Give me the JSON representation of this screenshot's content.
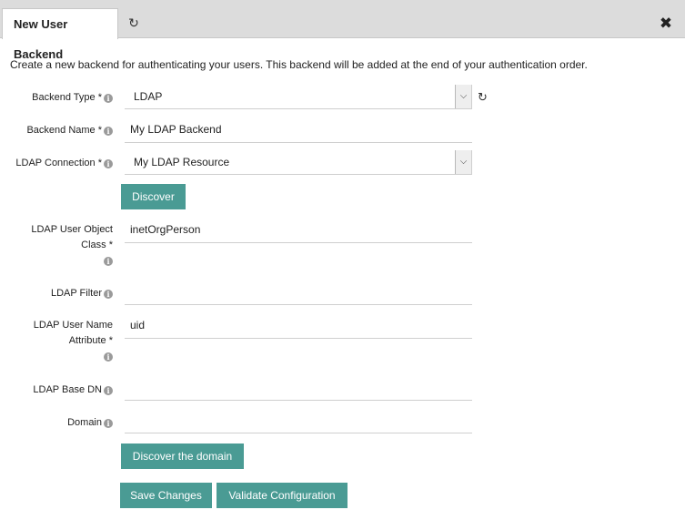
{
  "tabs": {
    "active_label": "New User Backend",
    "refresh_icon": "↻",
    "close_icon": "✖"
  },
  "description": "Create a new backend for authenticating your users. This backend will be added at the end of your authentication order.",
  "info_glyph": "i",
  "form": {
    "backend_type": {
      "label": "Backend Type *",
      "value": "LDAP",
      "refresh_icon": "↻"
    },
    "backend_name": {
      "label": "Backend Name *",
      "value": "My LDAP Backend"
    },
    "ldap_connection": {
      "label": "LDAP Connection *",
      "value": "My LDAP Resource"
    },
    "discover_label": "Discover",
    "user_object_class": {
      "label_line1": "LDAP User Object",
      "label_line2": "Class *",
      "value": "inetOrgPerson"
    },
    "ldap_filter": {
      "label": "LDAP Filter",
      "value": ""
    },
    "user_name_attribute": {
      "label_line1": "LDAP User Name",
      "label_line2": "Attribute *",
      "value": "uid"
    },
    "base_dn": {
      "label": "LDAP Base DN",
      "value": ""
    },
    "domain": {
      "label": "Domain",
      "value": ""
    },
    "discover_domain_label": "Discover the domain"
  },
  "actions": {
    "save_label": "Save Changes",
    "validate_label": "Validate Configuration"
  },
  "colors": {
    "button": "#4a9b94",
    "tabbar": "#dcdcdc"
  }
}
